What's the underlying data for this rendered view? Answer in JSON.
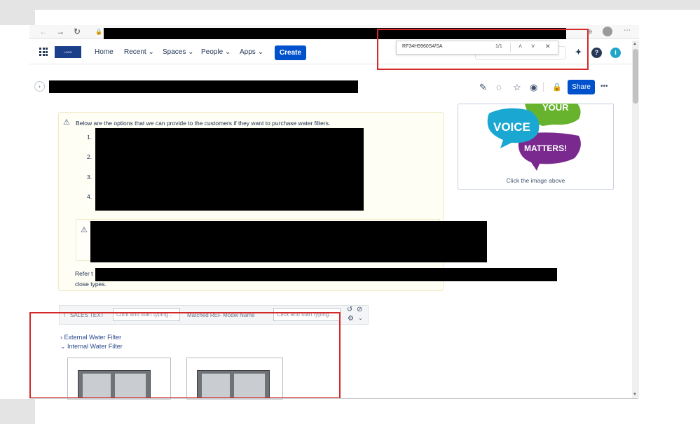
{
  "browser": {
    "back": "←",
    "forward": "→",
    "reload": "↻",
    "lock": "🔒",
    "menu": "⋯"
  },
  "find_bar": {
    "query": "RF34H9960S4/SA",
    "count": "1/1",
    "prev": "˄",
    "next": "˅",
    "close": "✕"
  },
  "header": {
    "logo_text": "LOGO",
    "nav": [
      "Home",
      "Recent ⌄",
      "Spaces ⌄",
      "People ⌄",
      "Apps ⌄"
    ],
    "create_label": "Create",
    "help": "?",
    "avatar": "i"
  },
  "page_actions": {
    "share_label": "Share",
    "more": "•••",
    "collapse": "›"
  },
  "content": {
    "note_intro": "Below are the options that we can provide to the customers if they want to purchase water filters.",
    "list_numbers": [
      "1.",
      "2.",
      "3.",
      "4."
    ],
    "refer_prefix": "Refer t",
    "close_types": "close types."
  },
  "voice_card": {
    "top_word": "YOUR",
    "voice_word": "VOICE",
    "matters_word": "MATTERS!",
    "caption": "Click the image above"
  },
  "filter_bar": {
    "label1": "SALES TEXT",
    "placeholder1": "Click and start typing...",
    "label2": "Matched REF Model Name",
    "placeholder2": "Click and start typing..."
  },
  "expanders": {
    "external": "› External Water Filter",
    "internal": "⌄ Internal Water Filter"
  },
  "colors": {
    "primary": "#0052cc",
    "highlight_red": "#d42a2a",
    "note_bg": "#fffef4"
  }
}
